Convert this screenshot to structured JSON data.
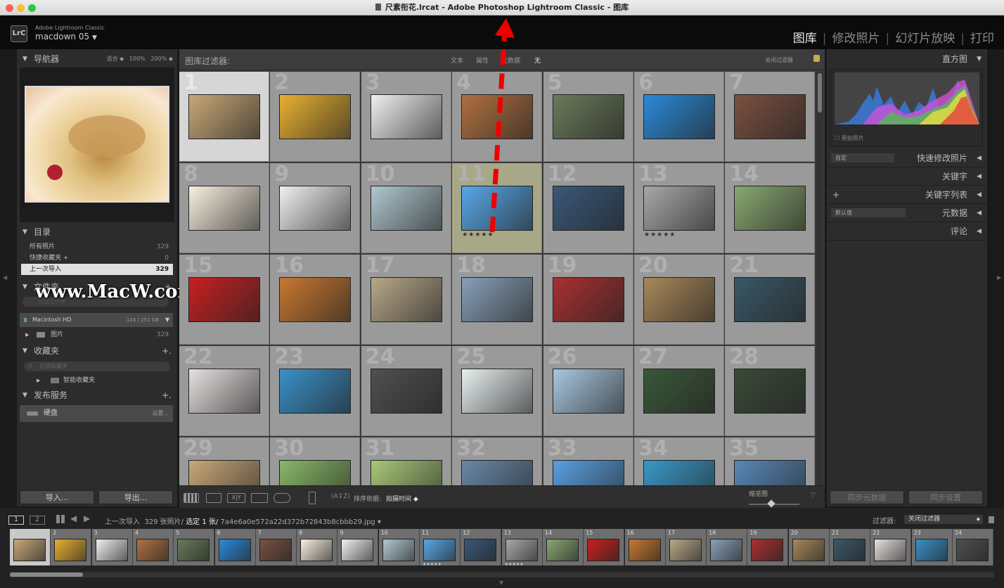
{
  "window": {
    "title": "尺素衔花.lrcat - Adobe Photoshop Lightroom Classic - 图库"
  },
  "identity": {
    "product": "Adobe Lightroom Classic",
    "user": "macdown 05",
    "logo": "LrC"
  },
  "modules": [
    {
      "label": "图库",
      "active": true
    },
    {
      "label": "修改照片",
      "active": false
    },
    {
      "label": "幻灯片放映",
      "active": false
    },
    {
      "label": "打印",
      "active": false
    }
  ],
  "navigator": {
    "title": "导航器",
    "zoom": [
      "适合",
      "100%",
      "200%"
    ]
  },
  "catalog": {
    "title": "目录",
    "items": [
      {
        "label": "所有照片",
        "count": "329"
      },
      {
        "label": "快捷收藏夹 +",
        "count": "0"
      },
      {
        "label": "上一次导入",
        "count": "329"
      }
    ]
  },
  "folders": {
    "title": "文件夹",
    "volume": "Macintosh HD",
    "volume_info": "124 / 251 GB",
    "folder": "图片",
    "folder_count": "329",
    "search_placeholder": "过滤文件夹"
  },
  "collections": {
    "title": "收藏夹",
    "search_placeholder": "过滤收藏夹",
    "smart": "智能收藏夹"
  },
  "publish": {
    "title": "发布服务",
    "service": "硬盘",
    "settings": "设置..."
  },
  "left_buttons": {
    "import": "导入...",
    "export": "导出..."
  },
  "watermark": "www.MacW.com",
  "filter": {
    "label": "图库过滤器:",
    "options": [
      "文本",
      "属性",
      "元数据",
      "无"
    ],
    "close": "关闭过滤器"
  },
  "grid": {
    "rows": 5,
    "cols": 7,
    "selected": 1,
    "highlighted": 11,
    "starred": [
      11,
      13
    ],
    "stars": "★★★★★",
    "colors": [
      "#c8a878",
      "#e8b030",
      "#f0f0f0",
      "#b07040",
      "#6a7a5a",
      "#2a8ad8",
      "#7a5040",
      "#f8f0e0",
      "#f0f0f0",
      "#b0c8d0",
      "#58a8e8",
      "#3a5878",
      "#a8a8a8",
      "#88a870",
      "#c82020",
      "#c87830",
      "#b8a888",
      "#88a0b8",
      "#a83030",
      "#a88858",
      "#3a5868",
      "#e8e0e0",
      "#3a90c8",
      "#505050",
      "#e8f0f0",
      "#a8c8e0",
      "#3a5838",
      "#3a4a38",
      "#c8a878",
      "#88b868",
      "#a8c878",
      "#6888a8",
      "#58a0e0",
      "#3a98c8",
      "#5888b8"
    ]
  },
  "toolbar": {
    "sort_label": "排序依据:",
    "sort_value": "拍摄时间",
    "thumb_label": "缩览图",
    "thumb_value": 0.45
  },
  "right": {
    "histogram": "直方图",
    "original": "原始照片",
    "quick": "快速修改照片",
    "quick_preset": "自定",
    "keywords": "关键字",
    "keyword_list": "关键字列表",
    "metadata": "元数据",
    "metadata_preset": "默认值",
    "comments": "评论",
    "sync_meta": "同步元数据",
    "sync_settings": "同步设置"
  },
  "filmstrip": {
    "screens": [
      "1",
      "2"
    ],
    "source": "上一次导入",
    "count": "329 张照片/",
    "selected": "选定 1 张/",
    "file": "7a4e6a0e572a22d372b72843b8cbbb29.jpg ▾",
    "filter_label": "过滤器:",
    "filter_value": "关闭过滤器",
    "thumbs": 24
  }
}
